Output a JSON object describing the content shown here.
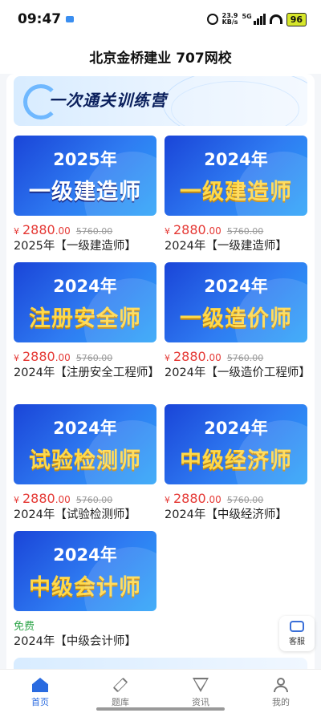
{
  "status_bar": {
    "time": "09:47",
    "net_speed_value": "23.9",
    "net_speed_unit": "KB/s",
    "network": "5G",
    "battery": "96"
  },
  "header": {
    "title": "北京金桥建业 707网校"
  },
  "camp_banner": {
    "title": "一次通关训练营"
  },
  "price_currency": "¥",
  "courses": [
    {
      "thumb_year": "2025年",
      "thumb_name": "一级建造师",
      "price_int": "2880",
      "price_dec": ".00",
      "original_price": "5760.00",
      "title": "2025年【一级建造师】"
    },
    {
      "thumb_year": "2024年",
      "thumb_name": "一级建造师",
      "price_int": "2880",
      "price_dec": ".00",
      "original_price": "5760.00",
      "title": "2024年【一级建造师】"
    },
    {
      "thumb_year": "2024年",
      "thumb_name": "注册安全师",
      "price_int": "2880",
      "price_dec": ".00",
      "original_price": "5760.00",
      "title": "2024年【注册安全工程师】"
    },
    {
      "thumb_year": "2024年",
      "thumb_name": "一级造价师",
      "price_int": "2880",
      "price_dec": ".00",
      "original_price": "5760.00",
      "title": "2024年【一级造价工程师】"
    },
    {
      "thumb_year": "2024年",
      "thumb_name": "试验检测师",
      "price_int": "2880",
      "price_dec": ".00",
      "original_price": "5760.00",
      "title": "2024年【试验检测师】"
    },
    {
      "thumb_year": "2024年",
      "thumb_name": "中级经济师",
      "price_int": "2880",
      "price_dec": ".00",
      "original_price": "5760.00",
      "title": "2024年【中级经济师】"
    },
    {
      "thumb_year": "2024年",
      "thumb_name": "中级会计师",
      "free_label": "免费",
      "title": "2024年【中级会计师】"
    }
  ],
  "floating": {
    "service_label": "客服"
  },
  "tabbar": [
    {
      "label": "首页",
      "icon": "home-icon",
      "active": true
    },
    {
      "label": "题库",
      "icon": "pen-icon",
      "active": false
    },
    {
      "label": "资讯",
      "icon": "news-icon",
      "active": false
    },
    {
      "label": "我的",
      "icon": "user-icon",
      "active": false
    }
  ],
  "colors": {
    "accent": "#2a6be0",
    "price": "#e53935",
    "free": "#2fa54a"
  }
}
